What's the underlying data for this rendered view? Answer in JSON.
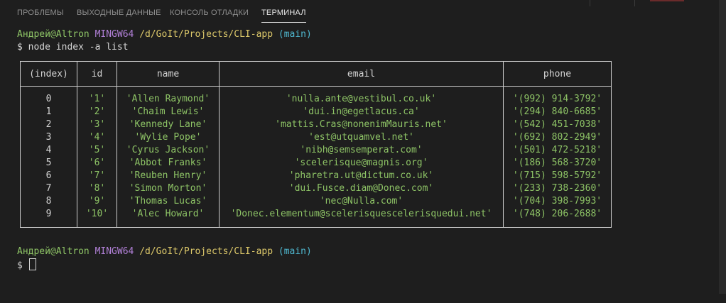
{
  "tabs": [
    {
      "label": "ПРОБЛЕМЫ",
      "active": false
    },
    {
      "label": "ВЫХОДНЫЕ ДАННЫЕ",
      "active": false
    },
    {
      "label": "КОНСОЛЬ ОТЛАДКИ",
      "active": false
    },
    {
      "label": "ТЕРМИНАЛ",
      "active": true
    }
  ],
  "prompt": {
    "user_host": "Андрей@Altron",
    "env": "MINGW64",
    "path": "/d/GoIt/Projects/CLI-app",
    "branch": "(main)"
  },
  "command": {
    "symbol": "$",
    "text": "node index -a list"
  },
  "table": {
    "headers": [
      "(index)",
      "id",
      "name",
      "email",
      "phone"
    ],
    "rows": [
      [
        "0",
        "'1'",
        "'Allen Raymond'",
        "'nulla.ante@vestibul.co.uk'",
        "'(992) 914-3792'"
      ],
      [
        "1",
        "'2'",
        "'Chaim Lewis'",
        "'dui.in@egetlacus.ca'",
        "'(294) 840-6685'"
      ],
      [
        "2",
        "'3'",
        "'Kennedy Lane'",
        "'mattis.Cras@nonenimMauris.net'",
        "'(542) 451-7038'"
      ],
      [
        "3",
        "'4'",
        "'Wylie Pope'",
        "'est@utquamvel.net'",
        "'(692) 802-2949'"
      ],
      [
        "4",
        "'5'",
        "'Cyrus Jackson'",
        "'nibh@semsemperat.com'",
        "'(501) 472-5218'"
      ],
      [
        "5",
        "'6'",
        "'Abbot Franks'",
        "'scelerisque@magnis.org'",
        "'(186) 568-3720'"
      ],
      [
        "6",
        "'7'",
        "'Reuben Henry'",
        "'pharetra.ut@dictum.co.uk'",
        "'(715) 598-5792'"
      ],
      [
        "7",
        "'8'",
        "'Simon Morton'",
        "'dui.Fusce.diam@Donec.com'",
        "'(233) 738-2360'"
      ],
      [
        "8",
        "'9'",
        "'Thomas Lucas'",
        "'nec@Nulla.com'",
        "'(704) 398-7993'"
      ],
      [
        "9",
        "'10'",
        "'Alec Howard'",
        "'Donec.elementum@scelerisquescelerisquedui.net'",
        "'(748) 206-2688'"
      ]
    ]
  },
  "colors": {
    "background": "#1e1e1e",
    "string": "#8ec466",
    "env": "#b180d7",
    "path": "#dcc86a",
    "branch": "#4fb8d0"
  }
}
